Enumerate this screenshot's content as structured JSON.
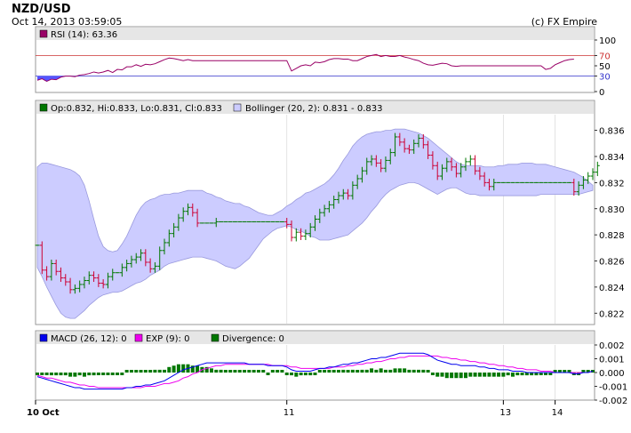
{
  "header": {
    "title": "NZD/USD",
    "datetime": "Oct 14, 2013 03:59:05",
    "copyright": "(c) FX Empire"
  },
  "chart_data": [
    {
      "type": "line",
      "legend": "RSI (14): 63.36",
      "series": [
        {
          "name": "RSI (14)",
          "values": [
            22,
            25,
            20,
            24,
            23,
            28,
            30,
            30,
            29,
            32,
            33,
            35,
            38,
            36,
            38,
            41,
            37,
            43,
            42,
            48,
            48,
            52,
            49,
            53,
            52,
            54,
            58,
            62,
            65,
            64,
            62,
            60,
            62,
            60,
            60,
            60,
            60,
            60,
            60,
            60,
            60,
            60,
            60,
            60,
            60,
            60,
            60,
            60,
            60,
            60,
            60,
            60,
            60,
            60,
            40,
            45,
            50,
            52,
            50,
            57,
            56,
            58,
            62,
            64,
            64,
            63,
            63,
            60,
            60,
            64,
            68,
            70,
            72,
            68,
            70,
            68,
            68,
            70,
            67,
            65,
            62,
            60,
            55,
            52,
            51,
            53,
            55,
            54,
            50,
            49,
            50,
            50,
            50,
            50,
            50,
            50,
            50,
            50,
            50,
            50,
            50,
            50,
            50,
            50,
            50,
            50,
            50,
            50,
            43,
            45,
            52,
            56,
            60,
            62,
            63
          ]
        }
      ],
      "levels": [
        70,
        30
      ],
      "ylim": [
        0,
        100
      ],
      "yticks": [
        "100",
        "70",
        "50",
        "30",
        "0"
      ]
    },
    {
      "type": "candlestick",
      "legend_ohlc": "Op:0.832, Hi:0.833, Lo:0.831, Cl:0.833",
      "legend_bb": "Bollinger (20, 2): 0.831 - 0.833",
      "ylim": [
        0.8212,
        0.8372
      ],
      "yticks": [
        "0.836",
        "0.834",
        "0.832",
        "0.830",
        "0.828",
        "0.826",
        "0.824",
        "0.822"
      ],
      "closes": [
        0.8272,
        0.8253,
        0.8248,
        0.8258,
        0.8252,
        0.8247,
        0.8244,
        0.8238,
        0.8239,
        0.8242,
        0.8245,
        0.8249,
        0.8247,
        0.8243,
        0.8242,
        0.8248,
        0.8251,
        0.8251,
        0.8255,
        0.8258,
        0.8261,
        0.8263,
        0.8266,
        0.8259,
        0.8254,
        0.8256,
        0.8268,
        0.8274,
        0.8281,
        0.8286,
        0.8293,
        0.8298,
        0.8301,
        0.8297,
        0.8289,
        0.8289,
        0.8289,
        0.8289,
        0.829,
        0.829,
        0.829,
        0.829,
        0.829,
        0.829,
        0.829,
        0.829,
        0.829,
        0.829,
        0.829,
        0.829,
        0.829,
        0.829,
        0.829,
        0.8288,
        0.8278,
        0.8282,
        0.8279,
        0.8281,
        0.8286,
        0.8292,
        0.8297,
        0.83,
        0.8303,
        0.8307,
        0.831,
        0.8312,
        0.831,
        0.8318,
        0.8323,
        0.8329,
        0.8336,
        0.8338,
        0.8335,
        0.8331,
        0.8337,
        0.8343,
        0.8355,
        0.8351,
        0.8346,
        0.8345,
        0.835,
        0.8354,
        0.8349,
        0.8341,
        0.8333,
        0.8325,
        0.8331,
        0.8336,
        0.8332,
        0.8327,
        0.8332,
        0.8336,
        0.8338,
        0.8329,
        0.8325,
        0.832,
        0.8317,
        0.832,
        0.832,
        0.832,
        0.832,
        0.832,
        0.832,
        0.832,
        0.832,
        0.832,
        0.832,
        0.832,
        0.832,
        0.832,
        0.832,
        0.832,
        0.832,
        0.832,
        0.8313,
        0.8318,
        0.8322,
        0.8325,
        0.8328,
        0.8333
      ],
      "bollinger_upper": [
        0.8332,
        0.8335,
        0.8335,
        0.8334,
        0.8333,
        0.8332,
        0.8331,
        0.833,
        0.8328,
        0.8325,
        0.8318,
        0.8306,
        0.8292,
        0.8279,
        0.8271,
        0.8268,
        0.8267,
        0.8268,
        0.8273,
        0.8279,
        0.8287,
        0.8295,
        0.8301,
        0.8305,
        0.8307,
        0.8308,
        0.831,
        0.8311,
        0.8311,
        0.8312,
        0.8312,
        0.8313,
        0.8314,
        0.8314,
        0.8314,
        0.8314,
        0.8312,
        0.8311,
        0.8309,
        0.8308,
        0.8306,
        0.8305,
        0.8304,
        0.8304,
        0.8302,
        0.8301,
        0.8299,
        0.8297,
        0.8296,
        0.8295,
        0.8295,
        0.8297,
        0.8299,
        0.8302,
        0.8304,
        0.8307,
        0.8309,
        0.8312,
        0.8313,
        0.8315,
        0.8317,
        0.8319,
        0.8322,
        0.8326,
        0.8331,
        0.8337,
        0.8342,
        0.8348,
        0.8352,
        0.8355,
        0.8357,
        0.8358,
        0.8359,
        0.8359,
        0.836,
        0.836,
        0.8361,
        0.8361,
        0.8361,
        0.836,
        0.8359,
        0.8358,
        0.8356,
        0.8354,
        0.8351,
        0.8348,
        0.8345,
        0.8342,
        0.8339,
        0.8336,
        0.8334,
        0.8333,
        0.8333,
        0.8333,
        0.8333,
        0.8332,
        0.8332,
        0.8332,
        0.8333,
        0.8333,
        0.8334,
        0.8334,
        0.8334,
        0.8335,
        0.8335,
        0.8335,
        0.8334,
        0.8334,
        0.8334,
        0.8333,
        0.8332,
        0.8331,
        0.833,
        0.8329,
        0.8328,
        0.8326,
        0.8324,
        0.8321,
        0.8318
      ],
      "bollinger_lower": [
        0.8255,
        0.8248,
        0.824,
        0.8233,
        0.8226,
        0.822,
        0.8217,
        0.8216,
        0.8216,
        0.8219,
        0.8222,
        0.8226,
        0.8229,
        0.8232,
        0.8234,
        0.8235,
        0.8236,
        0.8236,
        0.8237,
        0.8239,
        0.8241,
        0.8243,
        0.8244,
        0.8246,
        0.8249,
        0.8251,
        0.8253,
        0.8256,
        0.8258,
        0.8259,
        0.826,
        0.8261,
        0.8262,
        0.8263,
        0.8263,
        0.8263,
        0.8262,
        0.8261,
        0.826,
        0.8258,
        0.8256,
        0.8255,
        0.8254,
        0.8256,
        0.8259,
        0.8262,
        0.8267,
        0.8272,
        0.8277,
        0.828,
        0.8283,
        0.8285,
        0.8286,
        0.8287,
        0.8286,
        0.8284,
        0.8283,
        0.8281,
        0.8279,
        0.8278,
        0.8276,
        0.8276,
        0.8276,
        0.8277,
        0.8278,
        0.8279,
        0.828,
        0.8283,
        0.8286,
        0.8289,
        0.8293,
        0.8298,
        0.8302,
        0.8307,
        0.8311,
        0.8314,
        0.8316,
        0.8318,
        0.8319,
        0.832,
        0.832,
        0.8319,
        0.8317,
        0.8315,
        0.8313,
        0.8311,
        0.8313,
        0.8315,
        0.8316,
        0.8316,
        0.8314,
        0.8312,
        0.8311,
        0.8311,
        0.831,
        0.831,
        0.831,
        0.831,
        0.831,
        0.831,
        0.831,
        0.831,
        0.831,
        0.831,
        0.831,
        0.831,
        0.831,
        0.8311,
        0.8311,
        0.8311,
        0.8311,
        0.8311,
        0.8311,
        0.8311,
        0.8311,
        0.8311,
        0.8312,
        0.8313,
        0.8314
      ],
      "colors": {
        "up": "#007700",
        "down": "#cc0033",
        "band": "#ccccff",
        "band_edge": "#9999dd"
      }
    },
    {
      "type": "line",
      "legend_macd": "MACD (26, 12): 0",
      "legend_exp": "EXP (9): 0",
      "legend_div": "Divergence: 0",
      "ylim": [
        -0.002,
        0.002
      ],
      "yticks": [
        "0.002",
        "0.001",
        "0.000",
        "-0.001",
        "-0.002"
      ],
      "macd": [
        -0.0003,
        -0.0004,
        -0.0005,
        -0.0006,
        -0.0007,
        -0.0008,
        -0.0009,
        -0.001,
        -0.0011,
        -0.0011,
        -0.0012,
        -0.0012,
        -0.0012,
        -0.0012,
        -0.0012,
        -0.0012,
        -0.0012,
        -0.0012,
        -0.0012,
        -0.0011,
        -0.0011,
        -0.001,
        -0.001,
        -0.0009,
        -0.0009,
        -0.0008,
        -0.0007,
        -0.0006,
        -0.0004,
        -0.0002,
        0,
        0.0002,
        0.0003,
        0.0004,
        0.0005,
        0.0006,
        0.0007,
        0.0007,
        0.0007,
        0.0007,
        0.0007,
        0.0007,
        0.0007,
        0.0007,
        0.0007,
        0.0006,
        0.0006,
        0.0006,
        0.0006,
        0.0005,
        0.0005,
        0.0005,
        0.0005,
        0.0004,
        0.0002,
        0.0001,
        0.0001,
        0.0001,
        0.0001,
        0.0002,
        0.0003,
        0.0003,
        0.0004,
        0.0004,
        0.0005,
        0.0006,
        0.0006,
        0.0007,
        0.0007,
        0.0008,
        0.0009,
        0.001,
        0.001,
        0.0011,
        0.0011,
        0.0012,
        0.0013,
        0.0014,
        0.0014,
        0.0014,
        0.0014,
        0.0014,
        0.0014,
        0.0013,
        0.0011,
        0.0009,
        0.0008,
        0.0007,
        0.0006,
        0.0006,
        0.0005,
        0.0005,
        0.0005,
        0.0005,
        0.0004,
        0.0004,
        0.0003,
        0.0003,
        0.0002,
        0.0002,
        0.0002,
        0.0001,
        0.0001,
        0.0001,
        0,
        0,
        0,
        0,
        0,
        0,
        0,
        0,
        0,
        0,
        -0.0001,
        -0.0001,
        0,
        0,
        0.0001
      ],
      "exp": [
        -0.0002,
        -0.0003,
        -0.0004,
        -0.0004,
        -0.0005,
        -0.0006,
        -0.0007,
        -0.0007,
        -0.0008,
        -0.0009,
        -0.0009,
        -0.001,
        -0.001,
        -0.0011,
        -0.0011,
        -0.0011,
        -0.0011,
        -0.0011,
        -0.0011,
        -0.0011,
        -0.0011,
        -0.0011,
        -0.0011,
        -0.001,
        -0.001,
        -0.001,
        -0.0009,
        -0.0008,
        -0.0008,
        -0.0007,
        -0.0006,
        -0.0004,
        -0.0003,
        -0.0001,
        0,
        0.0002,
        0.0003,
        0.0004,
        0.0005,
        0.0005,
        0.0006,
        0.0006,
        0.0006,
        0.0006,
        0.0006,
        0.0006,
        0.0006,
        0.0006,
        0.0006,
        0.0006,
        0.0005,
        0.0005,
        0.0005,
        0.0005,
        0.0004,
        0.0004,
        0.0003,
        0.0003,
        0.0003,
        0.0003,
        0.0003,
        0.0003,
        0.0003,
        0.0004,
        0.0004,
        0.0004,
        0.0005,
        0.0005,
        0.0006,
        0.0006,
        0.0007,
        0.0007,
        0.0008,
        0.0008,
        0.0009,
        0.001,
        0.001,
        0.0011,
        0.0011,
        0.0012,
        0.0012,
        0.0012,
        0.0012,
        0.0012,
        0.0012,
        0.0012,
        0.0011,
        0.0011,
        0.001,
        0.001,
        0.0009,
        0.0009,
        0.0008,
        0.0008,
        0.0007,
        0.0007,
        0.0006,
        0.0006,
        0.0005,
        0.0005,
        0.0004,
        0.0004,
        0.0003,
        0.0003,
        0.0002,
        0.0002,
        0.0002,
        0.0001,
        0.0001,
        0.0001,
        0,
        0,
        0,
        0,
        0,
        0,
        0,
        0,
        0.0001
      ],
      "colors": {
        "macd": "#0000ee",
        "exp": "#ee00ee",
        "div": "#007700"
      }
    }
  ],
  "x_axis": {
    "n_bars": 119,
    "labels": [
      {
        "bar": 0,
        "label": "10 Oct",
        "bold": true
      },
      {
        "bar": 53,
        "label": "11",
        "bold": false
      },
      {
        "bar": 99,
        "label": "13",
        "bold": false
      },
      {
        "bar": 110,
        "label": "14",
        "bold": false
      }
    ]
  }
}
